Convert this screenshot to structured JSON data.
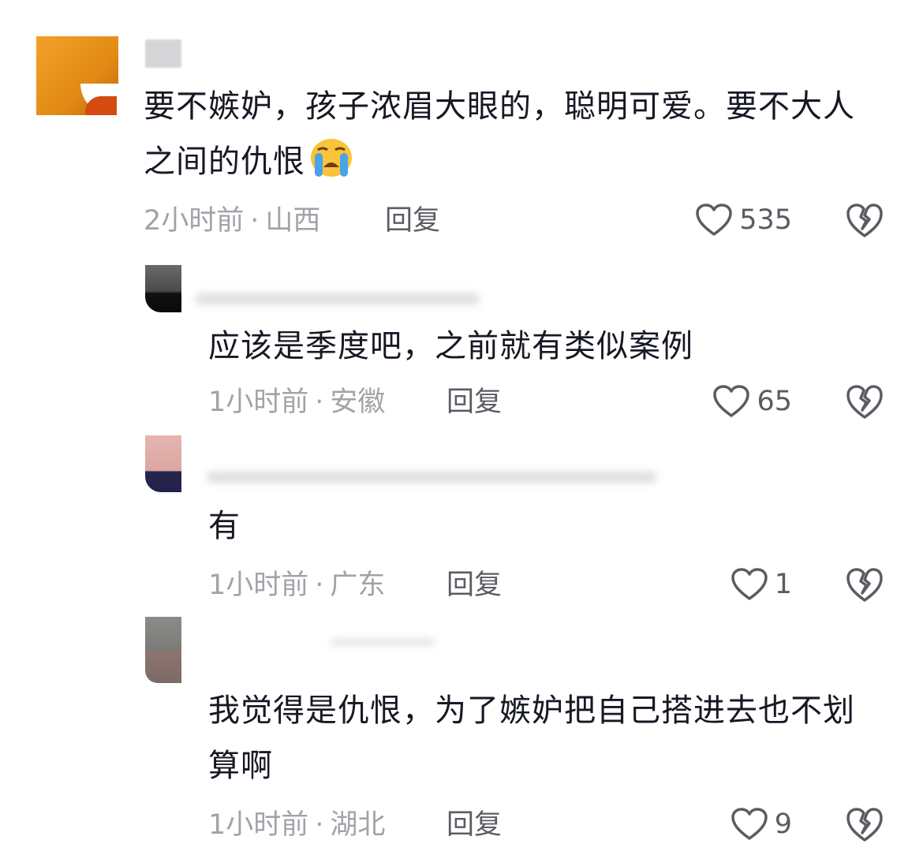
{
  "comments": [
    {
      "text": "要不嫉妒，孩子浓眉大眼的，聪明可爱。要不大人之间的仇恨",
      "emoji": "loudly-crying-face",
      "time": "2小时前",
      "location": "山西",
      "reply_label": "回复",
      "likes": "535"
    },
    {
      "text": "应该是季度吧，之前就有类似案例",
      "time": "1小时前",
      "location": "安徽",
      "reply_label": "回复",
      "likes": "65"
    },
    {
      "text": "有",
      "time": "1小时前",
      "location": "广东",
      "reply_label": "回复",
      "likes": "1"
    },
    {
      "text": "我觉得是仇恨，为了嫉妒把自己搭进去也不划算啊",
      "time": "1小时前",
      "location": "湖北",
      "reply_label": "回复",
      "likes": "9"
    }
  ],
  "separator": "·",
  "icons": {
    "like": "heart-outline-icon",
    "dislike": "broken-heart-icon"
  },
  "colors": {
    "text": "#161823",
    "meta": "#a2a3a8",
    "action": "#5b5c63"
  }
}
